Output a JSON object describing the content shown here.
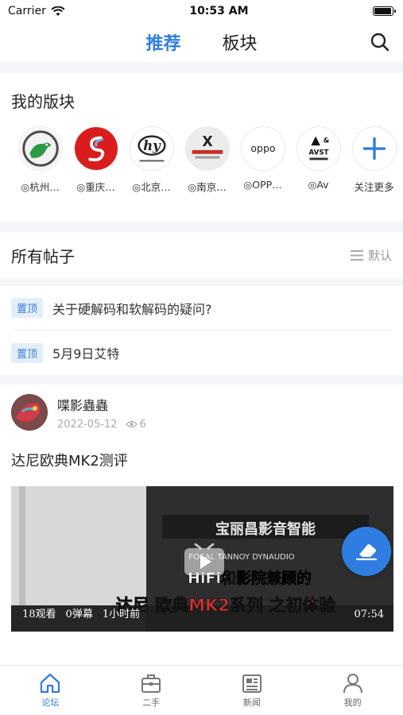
{
  "status_bar": {
    "carrier": "Carrier",
    "time": "10:53 AM",
    "battery": 0.95
  },
  "nav": {
    "tabs": [
      {
        "label": "推荐",
        "active": true
      },
      {
        "label": "板块",
        "active": false
      }
    ]
  },
  "my_boards": {
    "title": "我的版块",
    "items": [
      {
        "label": "◎杭州…",
        "icon": "green-bird-logo"
      },
      {
        "label": "◎重庆…",
        "icon": "red-circle-s-logo"
      },
      {
        "label": "◎北京…",
        "icon": "hy-logo",
        "logo_text": "hy"
      },
      {
        "label": "◎南京…",
        "icon": "x-logo",
        "logo_text": "X"
      },
      {
        "label": "◎OPP…",
        "icon": "oppo-logo",
        "logo_text": "oppo"
      },
      {
        "label": "◎Av",
        "icon": "avst-logo",
        "logo_text": "AVST"
      },
      {
        "label": "关注更多",
        "icon": "plus-icon"
      }
    ]
  },
  "posts": {
    "title": "所有帖子",
    "sort_label": "默认",
    "pinned": [
      {
        "badge": "置顶",
        "title": "关于硬解码和软解码的疑问?"
      },
      {
        "badge": "置顶",
        "title": "5月9日艾特"
      }
    ],
    "items": [
      {
        "author": "喋影蟲蟲",
        "date": "2022-05-12",
        "views": "6",
        "title": "达尼欧典MK2测评",
        "video": {
          "views": "18观看",
          "danmaku": "0弹幕",
          "ago": "1小时前",
          "duration": "07:54",
          "sign_text": "宝丽昌影音智能",
          "brands": "FOCAL TANNOY DYNAUDIO",
          "caption1": "HiFi和影院兼顾的",
          "caption2": "达尼 欧典MK2系列 之初体验"
        }
      }
    ]
  },
  "tabbar": {
    "tabs": [
      {
        "label": "论坛",
        "icon": "home-icon",
        "active": true
      },
      {
        "label": "二手",
        "icon": "briefcase-icon",
        "active": false
      },
      {
        "label": "新闻",
        "icon": "news-icon",
        "active": false
      },
      {
        "label": "我的",
        "icon": "user-icon",
        "active": false
      }
    ]
  },
  "colors": {
    "accent": "#2f7de1",
    "pin_badge_bg": "#e4eefb",
    "pin_badge_text": "#3a7cd6"
  }
}
